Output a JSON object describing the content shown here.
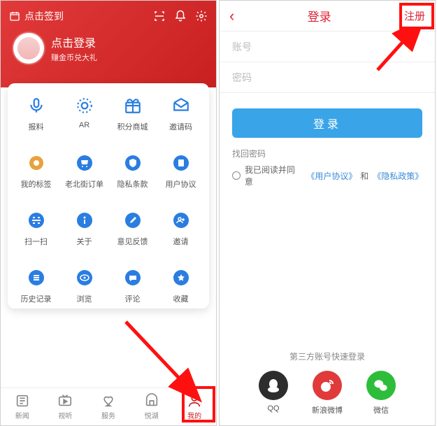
{
  "left": {
    "checkin": "点击签到",
    "login_title": "点击登录",
    "login_sub": "赚金币兑大礼",
    "grid_row1": [
      {
        "name": "baoliao",
        "label": "报料"
      },
      {
        "name": "ar",
        "label": "AR"
      },
      {
        "name": "mall",
        "label": "积分商城"
      },
      {
        "name": "invite-code",
        "label": "邀请码"
      }
    ],
    "grid_row2": [
      {
        "name": "my-tags",
        "label": "我的标签"
      },
      {
        "name": "orders",
        "label": "老北街订单"
      },
      {
        "name": "privacy",
        "label": "隐私条款"
      },
      {
        "name": "user-agree",
        "label": "用户协议"
      }
    ],
    "grid_row3": [
      {
        "name": "scan",
        "label": "扫一扫"
      },
      {
        "name": "about",
        "label": "关于"
      },
      {
        "name": "feedback",
        "label": "意见反馈"
      },
      {
        "name": "invite",
        "label": "邀请"
      }
    ],
    "grid_row4": [
      {
        "name": "history",
        "label": "历史记录"
      },
      {
        "name": "browse",
        "label": "浏览"
      },
      {
        "name": "comments",
        "label": "评论"
      },
      {
        "name": "favorites",
        "label": "收藏"
      }
    ],
    "nav": [
      {
        "name": "news",
        "label": "新闻"
      },
      {
        "name": "video",
        "label": "视听"
      },
      {
        "name": "service",
        "label": "服务"
      },
      {
        "name": "yuehu",
        "label": "悦湖"
      },
      {
        "name": "mine",
        "label": "我的"
      }
    ]
  },
  "right": {
    "title": "登录",
    "register": "注册",
    "ph_user": "账号",
    "ph_pass": "密码",
    "login_btn": "登录",
    "forgot": "找回密码",
    "agree_prefix": "我已阅读并同意",
    "agree_ua": "《用户协议》",
    "agree_and": "和",
    "agree_pp": "《隐私政策》",
    "third_caption": "第三方账号快速登录",
    "third": [
      {
        "name": "qq",
        "label": "QQ"
      },
      {
        "name": "weibo",
        "label": "新浪微博"
      },
      {
        "name": "wechat",
        "label": "微信"
      }
    ]
  }
}
